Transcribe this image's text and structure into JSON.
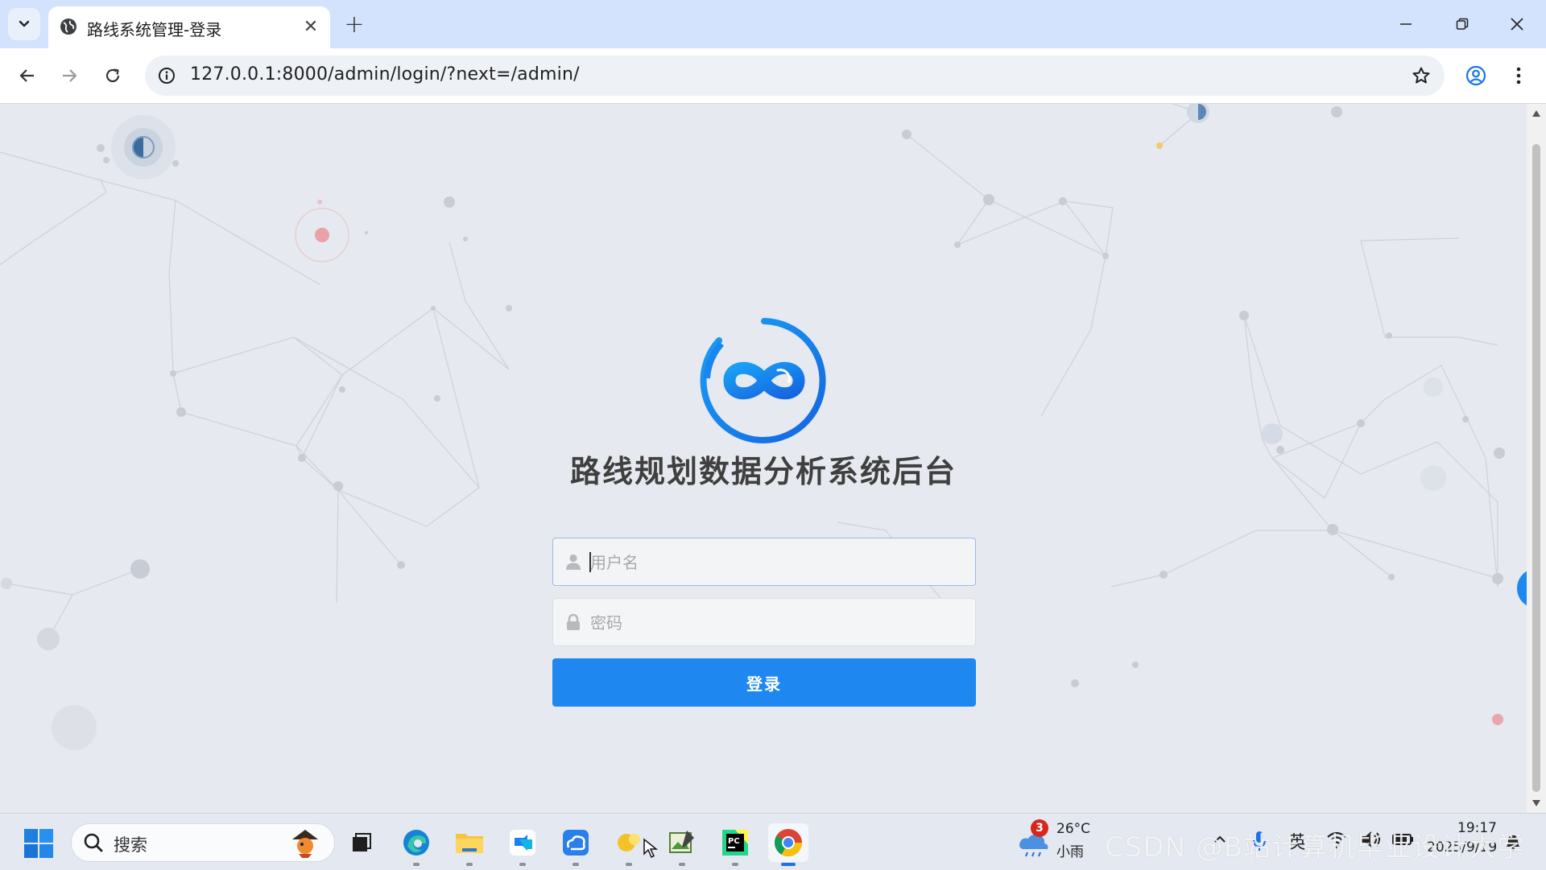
{
  "browser": {
    "tab_title": "路线系统管理-登录",
    "url": "127.0.0.1:8000/admin/login/?next=/admin/",
    "tab_close_glyph": "✕",
    "new_tab_glyph": "+"
  },
  "login": {
    "title": "路线规划数据分析系统后台",
    "username_placeholder": "用户名",
    "password_placeholder": "密码",
    "submit_label": "登录"
  },
  "taskbar": {
    "search_label": "搜索",
    "weather_temp": "26°C",
    "weather_desc": "小雨",
    "weather_badge": "3",
    "ime_lang": "英",
    "clock_time": "19:17",
    "clock_date": "2025/9/19",
    "watermark": "CSDN @B站计算机毕业设计大学"
  },
  "colors": {
    "accent": "#1e88f0",
    "tabstrip": "#d3e3fd",
    "page_bg": "#e6e9ef"
  },
  "icons": [
    "tab-list-icon",
    "globe-icon",
    "close-icon",
    "plus-icon",
    "minimize-icon",
    "restore-icon",
    "back-arrow-icon",
    "forward-arrow-icon",
    "reload-icon",
    "site-info-icon",
    "star-icon",
    "profile-icon",
    "kebab-menu-icon",
    "user-icon",
    "lock-icon",
    "chevron-left-icon",
    "windows-start-icon",
    "search-icon"
  ]
}
